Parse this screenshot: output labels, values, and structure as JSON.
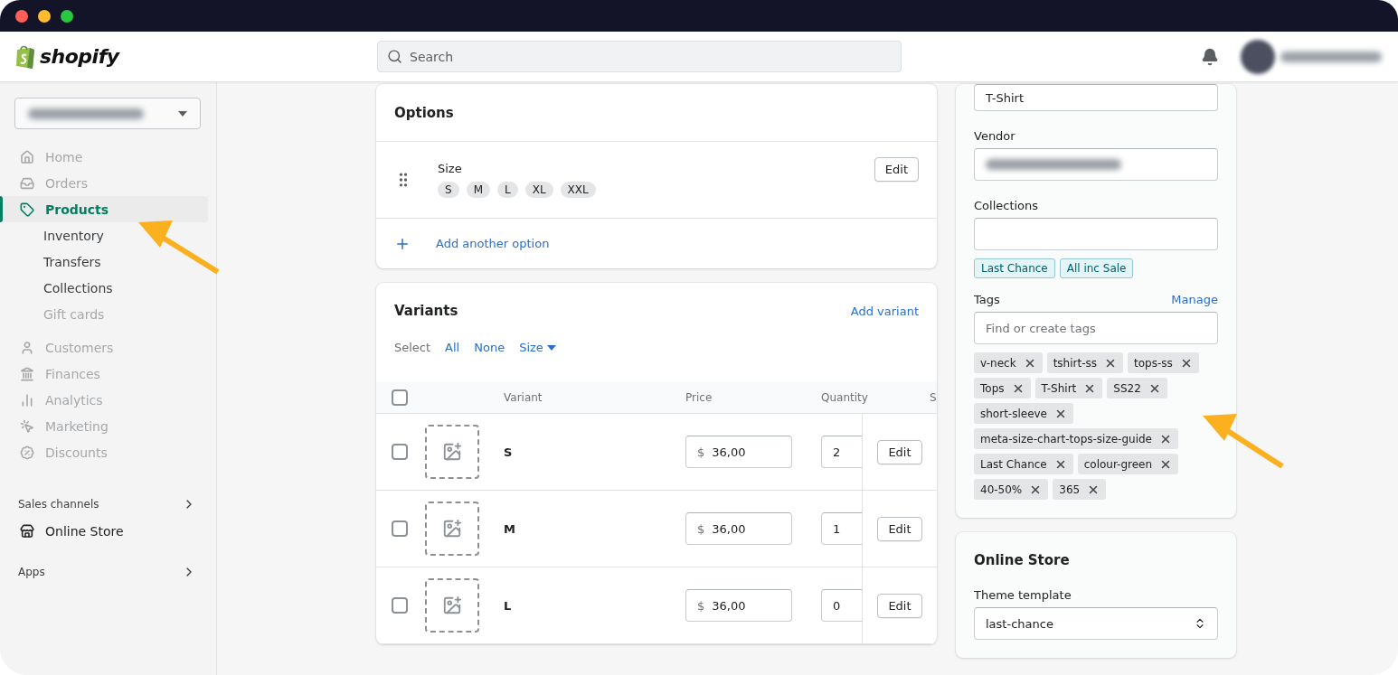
{
  "header": {
    "logo": "shopify",
    "search": {
      "placeholder": "Search"
    }
  },
  "sidebar": {
    "items": [
      {
        "label": "Home",
        "selected": false,
        "dimmed": true
      },
      {
        "label": "Orders",
        "selected": false,
        "dimmed": true
      },
      {
        "label": "Products",
        "selected": true,
        "dimmed": false,
        "children": [
          {
            "label": "Inventory",
            "selected": false,
            "dimmed": false
          },
          {
            "label": "Transfers",
            "selected": false,
            "dimmed": false
          },
          {
            "label": "Collections",
            "selected": false,
            "dimmed": false
          },
          {
            "label": "Gift cards",
            "selected": false,
            "dimmed": true
          }
        ]
      },
      {
        "label": "Customers",
        "selected": false,
        "dimmed": true
      },
      {
        "label": "Finances",
        "selected": false,
        "dimmed": true
      },
      {
        "label": "Analytics",
        "selected": false,
        "dimmed": true
      },
      {
        "label": "Marketing",
        "selected": false,
        "dimmed": true
      },
      {
        "label": "Discounts",
        "selected": false,
        "dimmed": true
      }
    ],
    "sales_channels": {
      "title": "Sales channels",
      "items": [
        {
          "label": "Online Store",
          "selected": false
        }
      ]
    },
    "apps": {
      "title": "Apps"
    }
  },
  "options": {
    "title": "Options",
    "option": {
      "name": "Size",
      "values": [
        "S",
        "M",
        "L",
        "XL",
        "XXL"
      ],
      "edit": "Edit"
    },
    "add_link": "Add another option"
  },
  "variants": {
    "title": "Variants",
    "add_link": "Add variant",
    "select_label": "Select",
    "select_links": [
      "All",
      "None",
      "Size"
    ],
    "table": {
      "select_all_checked": false,
      "columns": [
        "Variant",
        "Price",
        "Quantity",
        "S"
      ],
      "rows": [
        {
          "checked": false,
          "variant": "S",
          "currency": "$",
          "price": "36,00",
          "quantity": "2",
          "edit": "Edit"
        },
        {
          "checked": false,
          "variant": "M",
          "currency": "$",
          "price": "36,00",
          "quantity": "1",
          "edit": "Edit"
        },
        {
          "checked": false,
          "variant": "L",
          "currency": "$",
          "price": "36,00",
          "quantity": "0",
          "edit": "Edit"
        }
      ]
    }
  },
  "organization": {
    "type_value": "T-Shirt",
    "vendor_label": "Vendor",
    "collections_label": "Collections",
    "collections": [
      "Last Chance",
      "All inc Sale"
    ],
    "tags_label": "Tags",
    "manage_link": "Manage",
    "tags_placeholder": "Find or create tags",
    "tags": [
      "v-neck",
      "tshirt-ss",
      "tops-ss",
      "Tops",
      "T-Shirt",
      "SS22",
      "short-sleeve",
      "meta-size-chart-tops-size-guide",
      "Last Chance",
      "colour-green",
      "40-50%",
      "365"
    ]
  },
  "online_store": {
    "title": "Online Store",
    "template_label": "Theme template",
    "template_value": "last-chance"
  }
}
